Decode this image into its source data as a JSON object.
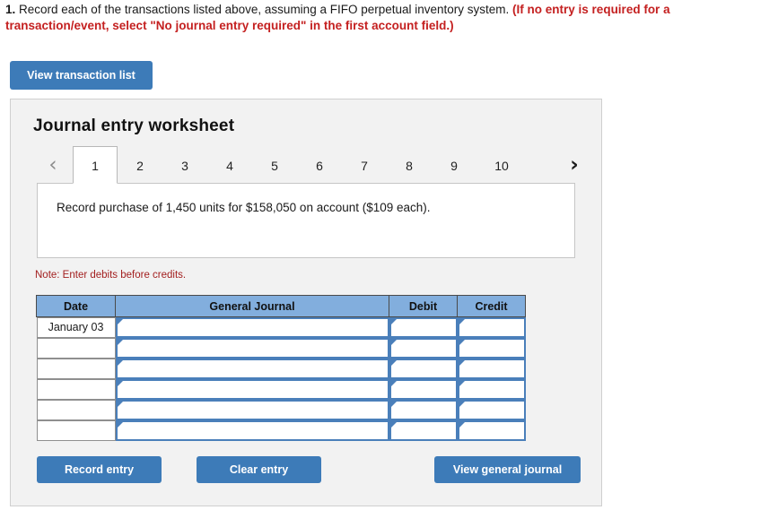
{
  "instruction": {
    "number": "1.",
    "black_text": " Record each of the transactions listed above, assuming a FIFO perpetual inventory system. ",
    "red_text": "(If no entry is required for a transaction/event, select \"No journal entry required\" in the first account field.)"
  },
  "toolbar": {
    "view_transaction_list_label": "View transaction list"
  },
  "panel": {
    "title": "Journal entry worksheet",
    "prev_arrow_icon": "chevron-left-icon",
    "next_arrow_icon": "chevron-right-icon",
    "tabs": [
      {
        "label": "1",
        "active": true
      },
      {
        "label": "2",
        "active": false
      },
      {
        "label": "3",
        "active": false
      },
      {
        "label": "4",
        "active": false
      },
      {
        "label": "5",
        "active": false
      },
      {
        "label": "6",
        "active": false
      },
      {
        "label": "7",
        "active": false
      },
      {
        "label": "8",
        "active": false
      },
      {
        "label": "9",
        "active": false
      },
      {
        "label": "10",
        "active": false
      }
    ],
    "description": "Record purchase of 1,450 units for $158,050 on account ($109 each).",
    "note": "Note: Enter debits before credits."
  },
  "journal_table": {
    "columns": [
      "Date",
      "General Journal",
      "Debit",
      "Credit"
    ],
    "rows": [
      {
        "date": "January 03",
        "general_journal": "",
        "debit": "",
        "credit": ""
      },
      {
        "date": "",
        "general_journal": "",
        "debit": "",
        "credit": ""
      },
      {
        "date": "",
        "general_journal": "",
        "debit": "",
        "credit": ""
      },
      {
        "date": "",
        "general_journal": "",
        "debit": "",
        "credit": ""
      },
      {
        "date": "",
        "general_journal": "",
        "debit": "",
        "credit": ""
      },
      {
        "date": "",
        "general_journal": "",
        "debit": "",
        "credit": ""
      }
    ]
  },
  "actions": {
    "record_entry_label": "Record entry",
    "clear_entry_label": "Clear entry",
    "view_general_journal_label": "View general journal"
  },
  "colors": {
    "button_blue": "#3d7bb8",
    "table_header_blue": "#82aedd",
    "input_border_blue": "#4a7fba",
    "red_alert": "#c42020",
    "note_red": "#a32020",
    "panel_bg": "#f2f2f2"
  }
}
